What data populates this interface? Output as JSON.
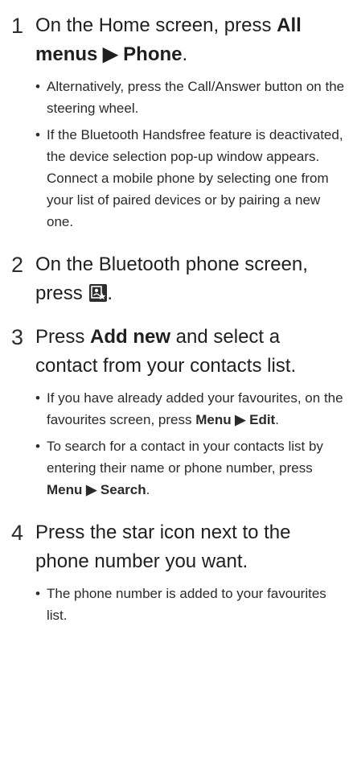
{
  "steps": [
    {
      "number": "1",
      "title_parts": [
        "On the Home screen, press ",
        "All menus",
        " ▶ ",
        "Phone",
        "."
      ],
      "bullets": [
        "Alternatively, press the Call/Answer button on the steering wheel.",
        "If the Bluetooth Handsfree feature is deactivated, the device selection pop-up window appears. Connect a mobile phone by selecting one from your list of paired devices or by pairing a new one."
      ]
    },
    {
      "number": "2",
      "title_parts": [
        "On the Bluetooth phone screen, press ",
        "."
      ],
      "icon": "contacts-star-icon"
    },
    {
      "number": "3",
      "title_parts": [
        "Press ",
        "Add new",
        " and select a contact from your contacts list."
      ],
      "bullets_parts": [
        [
          "If you have already added your favourites, on the favourites screen, press ",
          "Menu ▶ Edit",
          "."
        ],
        [
          "To search for a contact in your contacts list by entering their name or phone number, press ",
          "Menu ▶ Search",
          "."
        ]
      ]
    },
    {
      "number": "4",
      "title": "Press the star icon next to the phone number you want.",
      "bullets": [
        "The phone number is added to your favourites list."
      ]
    }
  ]
}
